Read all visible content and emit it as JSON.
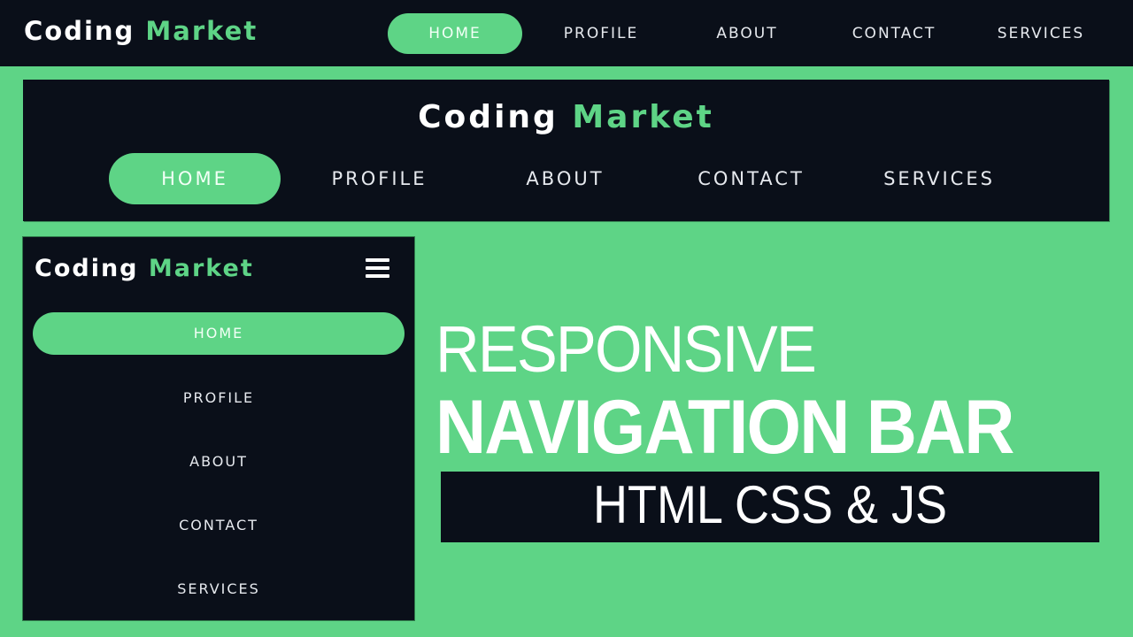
{
  "colors": {
    "accent": "#5ed486",
    "dark": "#0a0f19",
    "text": "#ffffff"
  },
  "brand": {
    "first": "Coding",
    "second": "Market"
  },
  "nav": {
    "items": [
      {
        "label": "HOME",
        "active": true
      },
      {
        "label": "PROFILE",
        "active": false
      },
      {
        "label": "ABOUT",
        "active": false
      },
      {
        "label": "CONTACT",
        "active": false
      },
      {
        "label": "SERVICES",
        "active": false
      }
    ]
  },
  "mobile": {
    "menu_icon": "hamburger-icon"
  },
  "headline": {
    "line1": "RESPONSIVE",
    "line2": "NAVIGATION BAR",
    "subtitle": "HTML CSS & JS"
  }
}
